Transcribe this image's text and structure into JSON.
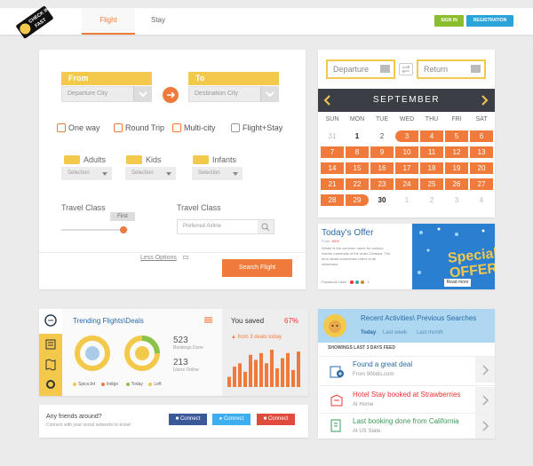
{
  "brand": {
    "logo_text_1": "CHECK IN",
    "logo_text_2": "FAST"
  },
  "nav": {
    "tabs": [
      {
        "label": "Flight",
        "active": true
      },
      {
        "label": "Stay",
        "active": false
      }
    ],
    "signin_label": "SIGN IN",
    "registration_label": "REGISTRATION"
  },
  "colors": {
    "accent": "#f07a3c",
    "yellow": "#f3c94b",
    "green": "#8cbd2c",
    "blue": "#2aa3d8",
    "dark": "#3b3f45"
  },
  "search": {
    "from_label": "From",
    "to_label": "To",
    "departure_city": "Departure City",
    "destination_city": "Destination City",
    "trip_types": [
      "One way",
      "Round Trip",
      "Multi-city",
      "Flight+Stay"
    ],
    "adults_label": "Adults",
    "kids_label": "Kids",
    "infants_label": "Infants",
    "selection": "Selection",
    "travel_class_label": "Travel Class",
    "travel_class_value": "First",
    "travel_class_level": 0.93,
    "travel_class_label_2": "Travel Class",
    "preferred_airline_placeholder": "Preferred Airline",
    "less_options": "Less Options",
    "search_button": "Search Flight"
  },
  "calendar": {
    "departure_label": "Departure",
    "return_label": "Return",
    "month": "SEPTEMBER",
    "weekdays": [
      "SUN",
      "MON",
      "TUE",
      "WED",
      "THU",
      "FRI",
      "SAT"
    ],
    "weeks": [
      [
        {
          "d": "31",
          "s": "muted"
        },
        {
          "d": "1",
          "s": "bold"
        },
        {
          "d": "2",
          "s": "normal"
        },
        {
          "d": "3",
          "s": "sel"
        },
        {
          "d": "4",
          "s": "sel"
        },
        {
          "d": "5",
          "s": "sel"
        },
        {
          "d": "6",
          "s": "sel"
        }
      ],
      [
        {
          "d": "7",
          "s": "sel"
        },
        {
          "d": "8",
          "s": "sel"
        },
        {
          "d": "9",
          "s": "sel"
        },
        {
          "d": "10",
          "s": "sel"
        },
        {
          "d": "11",
          "s": "sel"
        },
        {
          "d": "12",
          "s": "sel"
        },
        {
          "d": "13",
          "s": "sel"
        }
      ],
      [
        {
          "d": "14",
          "s": "sel"
        },
        {
          "d": "15",
          "s": "sel"
        },
        {
          "d": "16",
          "s": "sel"
        },
        {
          "d": "17",
          "s": "sel"
        },
        {
          "d": "18",
          "s": "sel"
        },
        {
          "d": "19",
          "s": "sel"
        },
        {
          "d": "20",
          "s": "sel"
        }
      ],
      [
        {
          "d": "21",
          "s": "sel"
        },
        {
          "d": "22",
          "s": "sel"
        },
        {
          "d": "23",
          "s": "sel"
        },
        {
          "d": "24",
          "s": "sel"
        },
        {
          "d": "25",
          "s": "sel"
        },
        {
          "d": "26",
          "s": "sel"
        },
        {
          "d": "27",
          "s": "sel"
        }
      ],
      [
        {
          "d": "28",
          "s": "sel"
        },
        {
          "d": "29",
          "s": "sel"
        },
        {
          "d": "30",
          "s": "bold"
        },
        {
          "d": "1",
          "s": "muted"
        },
        {
          "d": "2",
          "s": "muted"
        },
        {
          "d": "3",
          "s": "muted"
        },
        {
          "d": "4",
          "s": "muted"
        }
      ]
    ]
  },
  "offer": {
    "title": "Today's Offer",
    "from_label": "From:",
    "from_value": "90%",
    "body": "Whale is the common name for various marine mammals of the order Cetacea. The term whale sometimes refers to all cetaceans.",
    "likes_label": "Facebook Likes",
    "likes_count": "3",
    "banner_line1": "Special",
    "banner_line2": "OFFERS!",
    "read_more": "Read more"
  },
  "trending": {
    "title": "Trending Flights\\Deals",
    "bookings_count": "523",
    "bookings_label": "Bookings Done",
    "users_count": "213",
    "users_label": "Users Online",
    "legend": [
      "SpiceJet",
      "Indigo",
      "Today",
      "Left"
    ],
    "saved_label": "You saved",
    "saved_percent": "67%",
    "from_deals": "from 3 deals today",
    "bars": [
      6,
      12,
      14,
      9,
      19,
      16,
      20,
      14,
      22,
      11,
      17,
      20,
      10,
      21
    ]
  },
  "friends": {
    "title": "Any friends around?",
    "subtitle": "Connect with your social networks to know!",
    "buttons": [
      "Connect",
      "Connect",
      "Connect"
    ]
  },
  "recent": {
    "title": "Recent Activities\\ Previous Searches",
    "tabs": [
      "Today",
      "Last week",
      "Last month"
    ],
    "showing": "SHOWINGS LAST 3 DAYS FEED",
    "items": [
      {
        "title": "Found a great deal",
        "sub_prefix": "From",
        "sub_value": "90bids.com"
      },
      {
        "title": "Hotel Stay booked at Strawberries",
        "sub_prefix": "At",
        "sub_value": "Home"
      },
      {
        "title": "Last booking done from California",
        "sub_prefix": "At",
        "sub_value": "US State"
      }
    ]
  }
}
